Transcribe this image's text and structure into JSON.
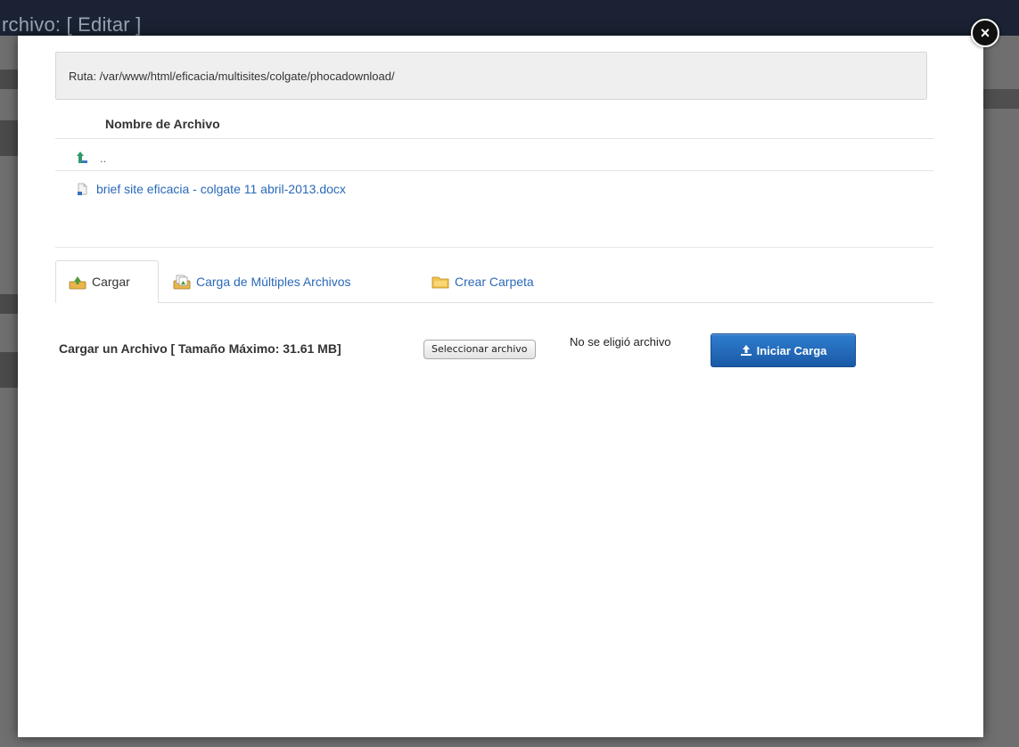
{
  "background": {
    "title": "rchivo: [ Editar ]"
  },
  "modal": {
    "close_label": "×",
    "path_label": "Ruta: /var/www/html/eficacia/multisites/colgate/phocadownload/",
    "file_list": {
      "column_header": "Nombre de Archivo",
      "parent_dir": "..",
      "files": [
        {
          "name": "brief site eficacia - colgate 11 abril-2013.docx"
        }
      ]
    },
    "tabs": [
      {
        "label": "Cargar",
        "icon": "upload-icon",
        "active": true
      },
      {
        "label": "Carga de Múltiples Archivos",
        "icon": "multi-upload-icon",
        "active": false
      },
      {
        "label": "Crear Carpeta",
        "icon": "folder-icon",
        "active": false
      }
    ],
    "upload": {
      "label": "Cargar un Archivo [ Tamaño Máximo: 31.61 MB]",
      "choose_button": "Seleccionar archivo",
      "no_file_text": "No se eligió archivo",
      "start_button": "Iniciar Carga"
    }
  },
  "colors": {
    "link": "#2a69b8",
    "primary_button": "#1f66b5",
    "path_box": "#efefef"
  }
}
